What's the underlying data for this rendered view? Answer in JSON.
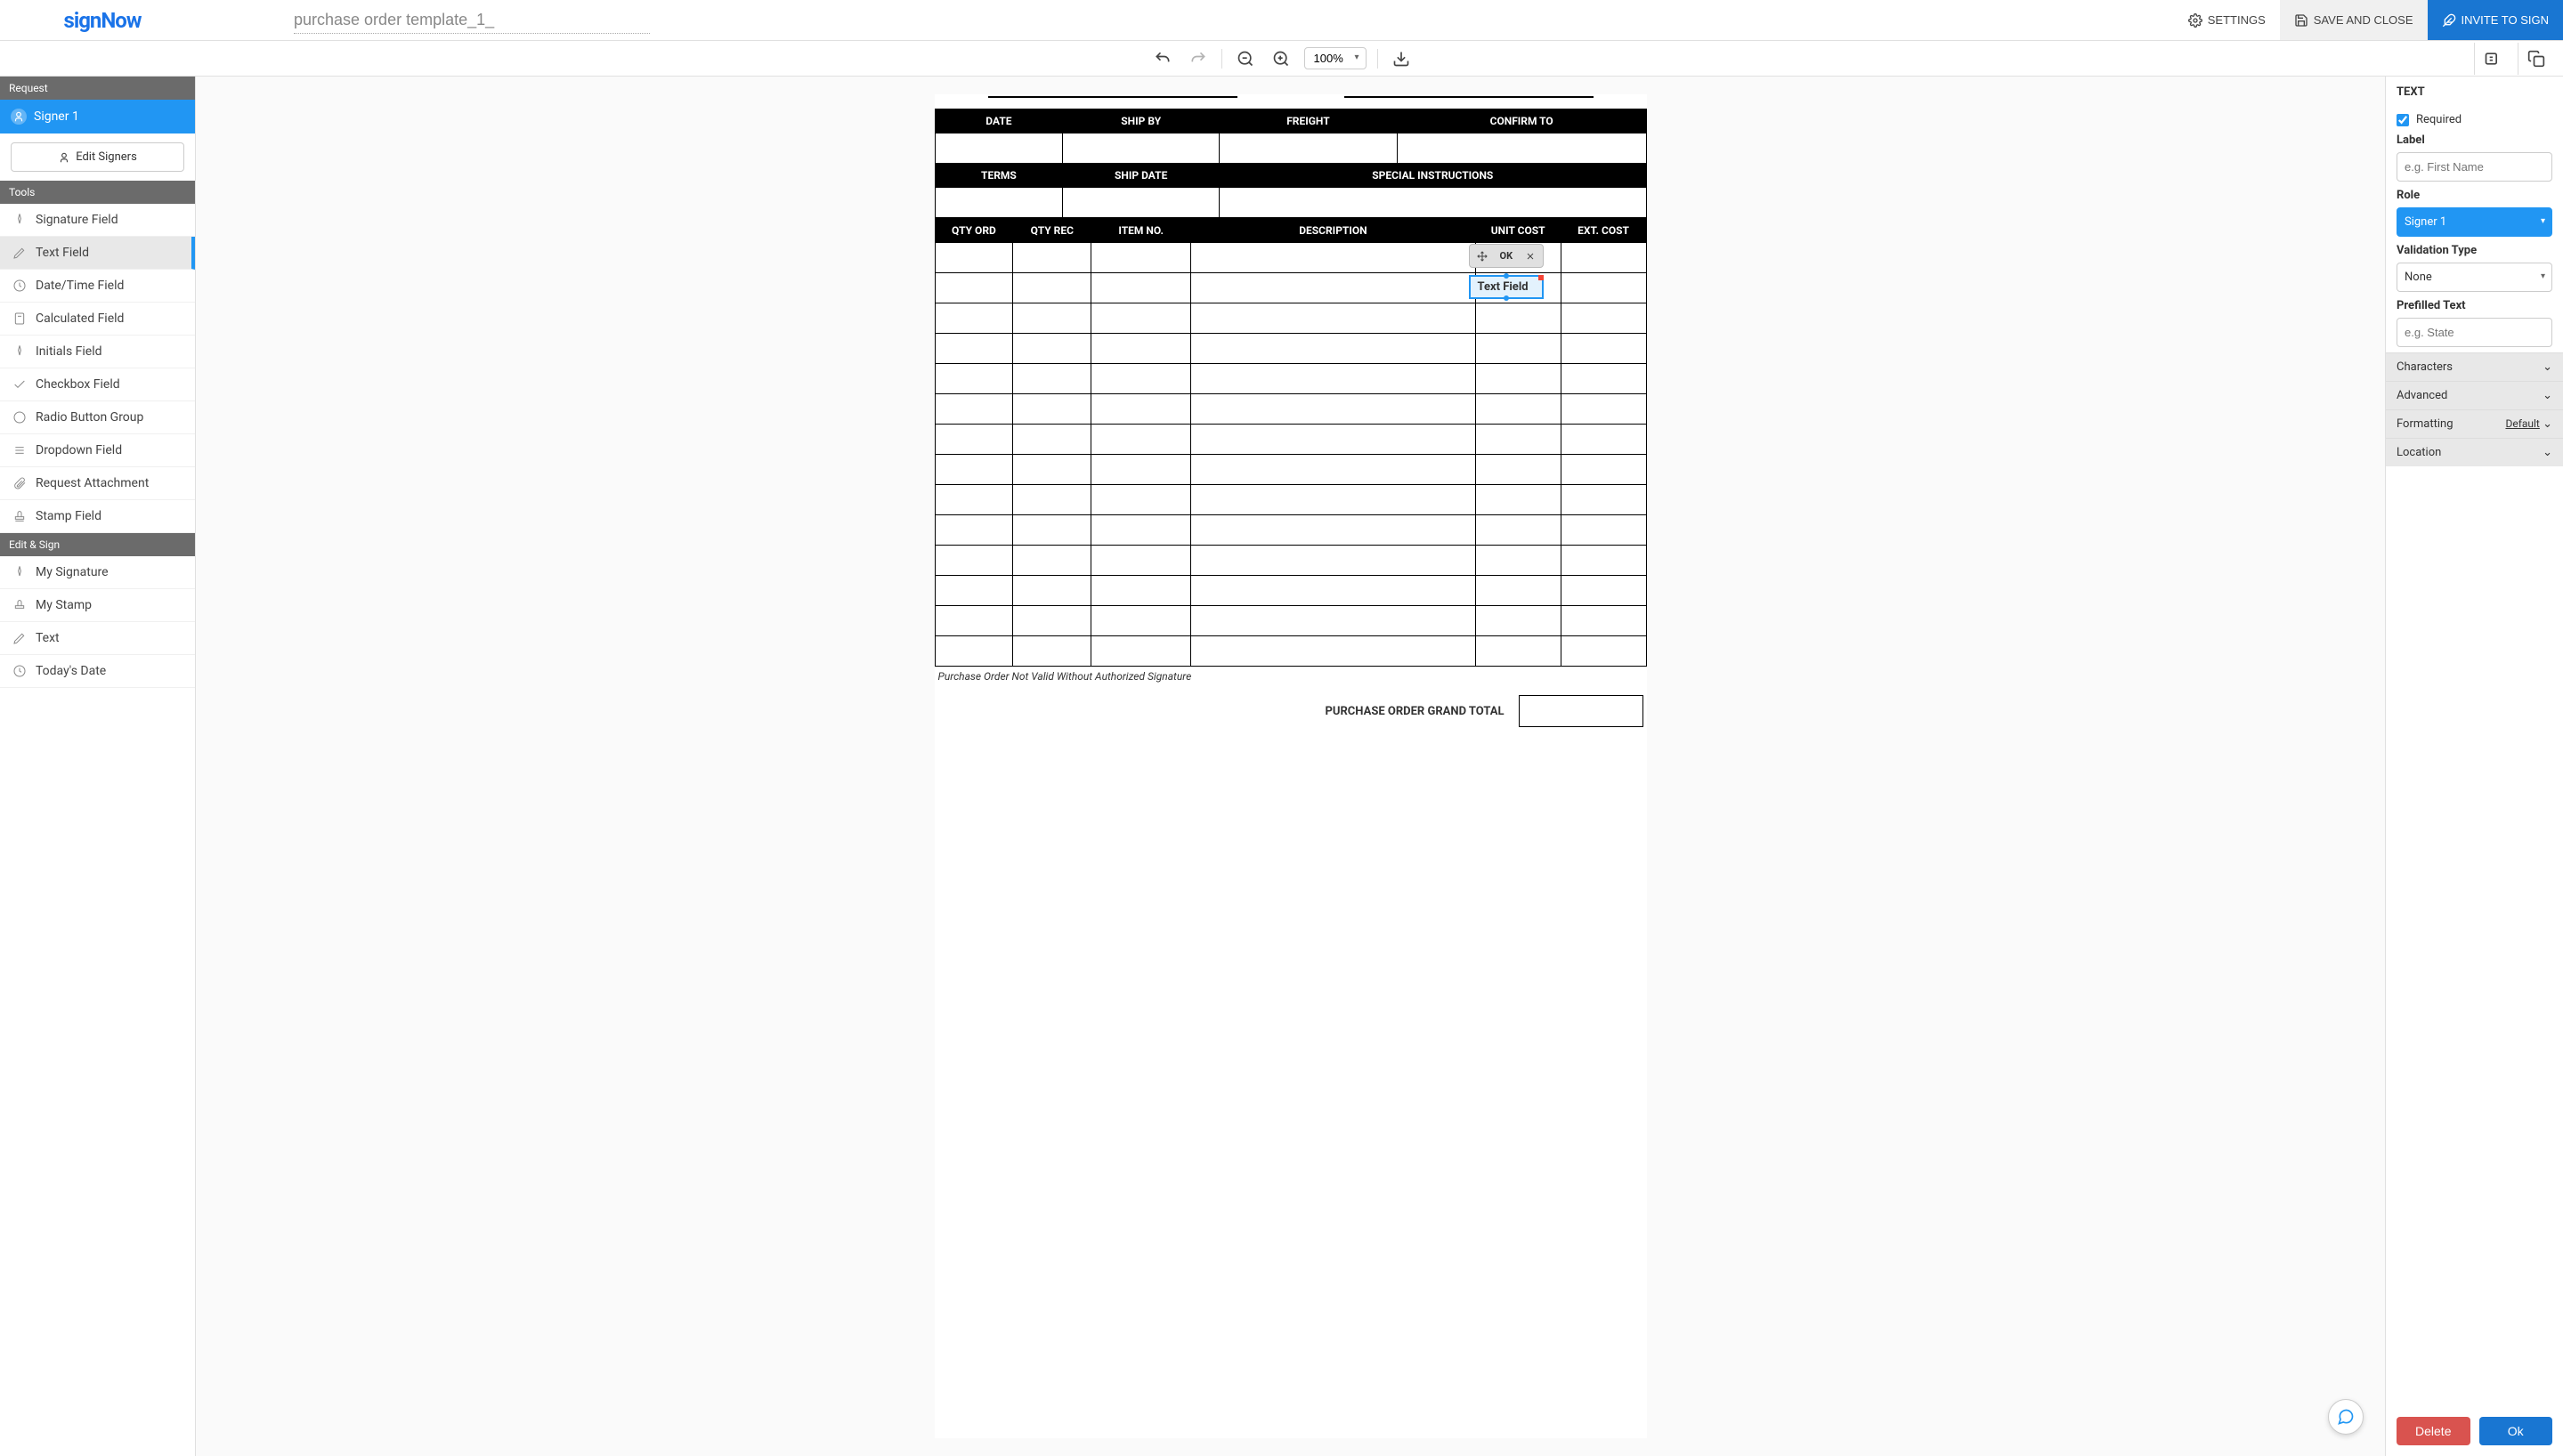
{
  "brand": "signNow",
  "document_title": "purchase order template_1_",
  "topbar": {
    "settings": "SETTINGS",
    "save": "SAVE AND CLOSE",
    "invite": "INVITE TO SIGN"
  },
  "zoom": "100%",
  "left": {
    "request_header": "Request",
    "signer": "Signer 1",
    "edit_signers": "Edit Signers",
    "tools_header": "Tools",
    "tools": [
      "Signature Field",
      "Text Field",
      "Date/Time Field",
      "Calculated Field",
      "Initials Field",
      "Checkbox Field",
      "Radio Button Group",
      "Dropdown Field",
      "Request Attachment",
      "Stamp Field"
    ],
    "edit_sign_header": "Edit & Sign",
    "edit_sign": [
      "My Signature",
      "My Stamp",
      "Text",
      "Today's Date"
    ]
  },
  "po": {
    "headers1": [
      "DATE",
      "SHIP BY",
      "FREIGHT",
      "CONFIRM TO"
    ],
    "headers2": [
      "TERMS",
      "SHIP DATE",
      "SPECIAL INSTRUCTIONS"
    ],
    "headers3": [
      "QTY ORD",
      "QTY REC",
      "ITEM NO.",
      "DESCRIPTION",
      "UNIT COST",
      "EXT. COST"
    ],
    "footnote": "Purchase Order Not Valid Without Authorized Signature",
    "grand_total": "PURCHASE ORDER GRAND TOTAL"
  },
  "field_overlay": {
    "ok": "OK",
    "label": "Text Field"
  },
  "right": {
    "title": "TEXT",
    "required": "Required",
    "label": "Label",
    "label_ph": "e.g. First Name",
    "role": "Role",
    "role_value": "Signer 1",
    "validation": "Validation Type",
    "validation_value": "None",
    "prefilled": "Prefilled Text",
    "prefilled_ph": "e.g. State",
    "sections": {
      "characters": "Characters",
      "advanced": "Advanced",
      "formatting": "Formatting",
      "formatting_val": "Default",
      "location": "Location"
    },
    "delete": "Delete",
    "ok": "Ok"
  }
}
